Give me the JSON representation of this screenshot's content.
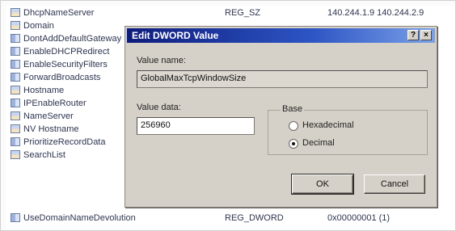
{
  "registry": {
    "rows": [
      {
        "name": "DhcpNameServer",
        "type": "REG_SZ",
        "data": "140.244.1.9 140.244.2.9",
        "icon": "string-value-icon"
      },
      {
        "name": "Domain",
        "type": "",
        "data": "",
        "icon": "string-value-icon"
      },
      {
        "name": "DontAddDefaultGateway",
        "type": "",
        "data": "",
        "icon": "binary-value-icon"
      },
      {
        "name": "EnableDHCPRedirect",
        "type": "",
        "data": "",
        "icon": "binary-value-icon"
      },
      {
        "name": "EnableSecurityFilters",
        "type": "",
        "data": "",
        "icon": "binary-value-icon"
      },
      {
        "name": "ForwardBroadcasts",
        "type": "",
        "data": "",
        "icon": "binary-value-icon"
      },
      {
        "name": "Hostname",
        "type": "",
        "data": "",
        "icon": "string-value-icon"
      },
      {
        "name": "IPEnableRouter",
        "type": "",
        "data": "",
        "icon": "binary-value-icon"
      },
      {
        "name": "NameServer",
        "type": "",
        "data": "",
        "icon": "string-value-icon"
      },
      {
        "name": "NV Hostname",
        "type": "",
        "data": "",
        "icon": "string-value-icon"
      },
      {
        "name": "PrioritizeRecordData",
        "type": "",
        "data": "",
        "icon": "binary-value-icon"
      },
      {
        "name": "SearchList",
        "type": "",
        "data": "",
        "icon": "string-value-icon"
      },
      {
        "name": "UseDomainNameDevolution",
        "type": "REG_DWORD",
        "data": "0x00000001 (1)",
        "icon": "binary-value-icon"
      }
    ]
  },
  "dialog": {
    "title": "Edit DWORD Value",
    "help_glyph": "?",
    "close_glyph": "×",
    "value_name_label": "Value name:",
    "value_name": "GlobalMaxTcpWindowSize",
    "value_data_label": "Value data:",
    "value_data": "256960",
    "base_label": "Base",
    "base_options": [
      {
        "label": "Hexadecimal",
        "selected": false
      },
      {
        "label": "Decimal",
        "selected": true
      }
    ],
    "ok_label": "OK",
    "cancel_label": "Cancel"
  }
}
